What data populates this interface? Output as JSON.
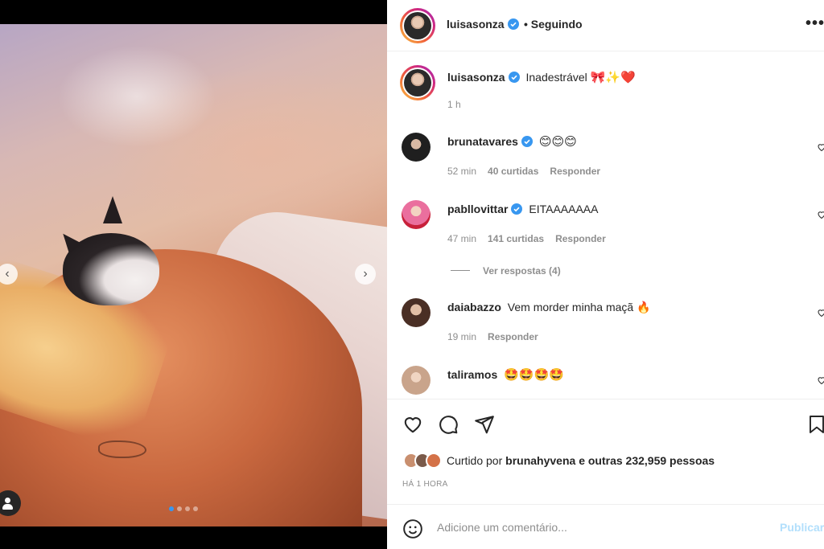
{
  "post": {
    "author": "luisasonza",
    "follow_status": "Seguindo",
    "more": "•••",
    "caption_text": "Inadestrável",
    "caption_emoji": "🎀✨❤️",
    "caption_time": "1 h",
    "carousel": {
      "total": 4,
      "active": 1
    }
  },
  "comments": [
    {
      "user": "brunatavares",
      "verified": true,
      "text": "😊😊😊",
      "time": "52 min",
      "likes": "40 curtidas",
      "reply": "Responder",
      "avatar_color": "#1f1f1f"
    },
    {
      "user": "pabllovittar",
      "verified": true,
      "text": "EITAAAAAAA",
      "time": "47 min",
      "likes": "141 curtidas",
      "reply": "Responder",
      "avatar_color": "#e85a8a"
    },
    {
      "user": "daiabazzo",
      "verified": false,
      "text": "Vem morder minha maçã 🔥",
      "time": "19 min",
      "likes": "",
      "reply": "Responder",
      "avatar_color": "#6b4a3b"
    },
    {
      "user": "taliramos",
      "verified": false,
      "text": "🤩🤩🤩🤩",
      "time": "",
      "likes": "",
      "reply": "",
      "avatar_color": "#c9a48b"
    }
  ],
  "view_replies": "Ver respostas (4)",
  "likes_line": {
    "prefix": "Curtido por",
    "user": "brunahyvena",
    "suffix": "e outras 232,959 pessoas"
  },
  "time_ago": "HÁ 1 HORA",
  "add_comment": {
    "placeholder": "Adicione um comentário...",
    "post_label": "Publicar"
  },
  "colors": {
    "verified": "#3897f0",
    "link_disabled": "#b2dffc",
    "muted": "#8e8e8e"
  },
  "icons": [
    "like-icon",
    "comment-icon",
    "share-icon",
    "save-icon",
    "emoji-icon",
    "more-icon",
    "user-tag-icon",
    "verified-icon",
    "chevron-left-icon",
    "chevron-right-icon"
  ]
}
